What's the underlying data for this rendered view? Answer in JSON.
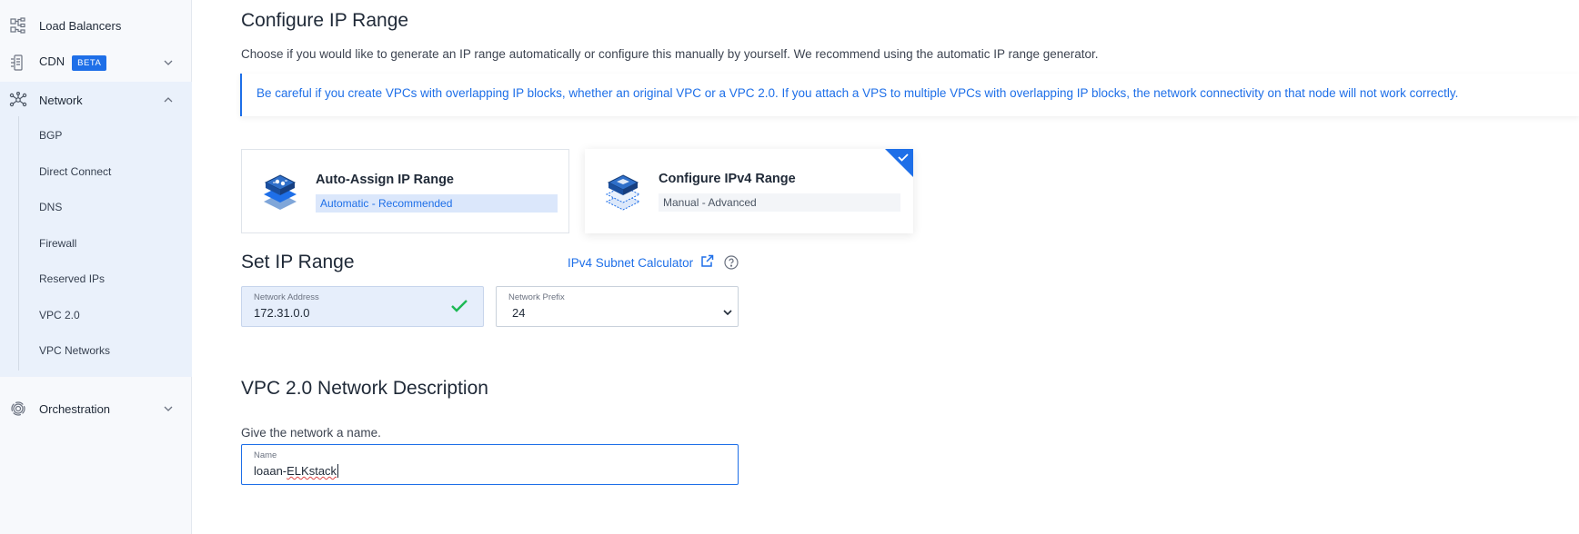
{
  "sidebar": {
    "items": [
      {
        "label": "Load Balancers",
        "icon": "load-balancer-icon"
      },
      {
        "label": "CDN",
        "badge": "BETA",
        "icon": "cdn-icon"
      },
      {
        "label": "Network",
        "icon": "network-icon",
        "expanded": true
      },
      {
        "label": "Orchestration",
        "icon": "orchestration-icon"
      }
    ],
    "network_sub": [
      "BGP",
      "Direct Connect",
      "DNS",
      "Firewall",
      "Reserved IPs",
      "VPC 2.0",
      "VPC Networks"
    ]
  },
  "main": {
    "title": "Configure IP Range",
    "intro": "Choose if you would like to generate an IP range automatically or configure this manually by yourself. We recommend using the automatic IP range generator.",
    "alert": "Be careful if you create VPCs with overlapping IP blocks, whether an original VPC or a VPC 2.0. If you attach a VPS to multiple VPCs with overlapping IP blocks, the network connectivity on that node will not work correctly.",
    "cards": [
      {
        "title": "Auto-Assign IP Range",
        "subtitle": "Automatic - Recommended",
        "selected": false
      },
      {
        "title": "Configure IPv4 Range",
        "subtitle": "Manual - Advanced",
        "selected": true
      }
    ],
    "set_range": {
      "title": "Set IP Range",
      "calculator_link": "IPv4 Subnet Calculator",
      "network_address": {
        "label": "Network Address",
        "value": "172.31.0.0"
      },
      "network_prefix": {
        "label": "Network Prefix",
        "value": "24"
      }
    },
    "description": {
      "title": "VPC 2.0 Network Description",
      "prompt": "Give the network a name.",
      "name_label": "Name",
      "name_prefix": "loaan-",
      "name_misspelled": "ELKstack"
    }
  },
  "colors": {
    "accent": "#1e6fe8",
    "success": "#1db954",
    "sidebar_bg": "#f7f9fc",
    "active_group_bg": "#eaf1fb"
  }
}
